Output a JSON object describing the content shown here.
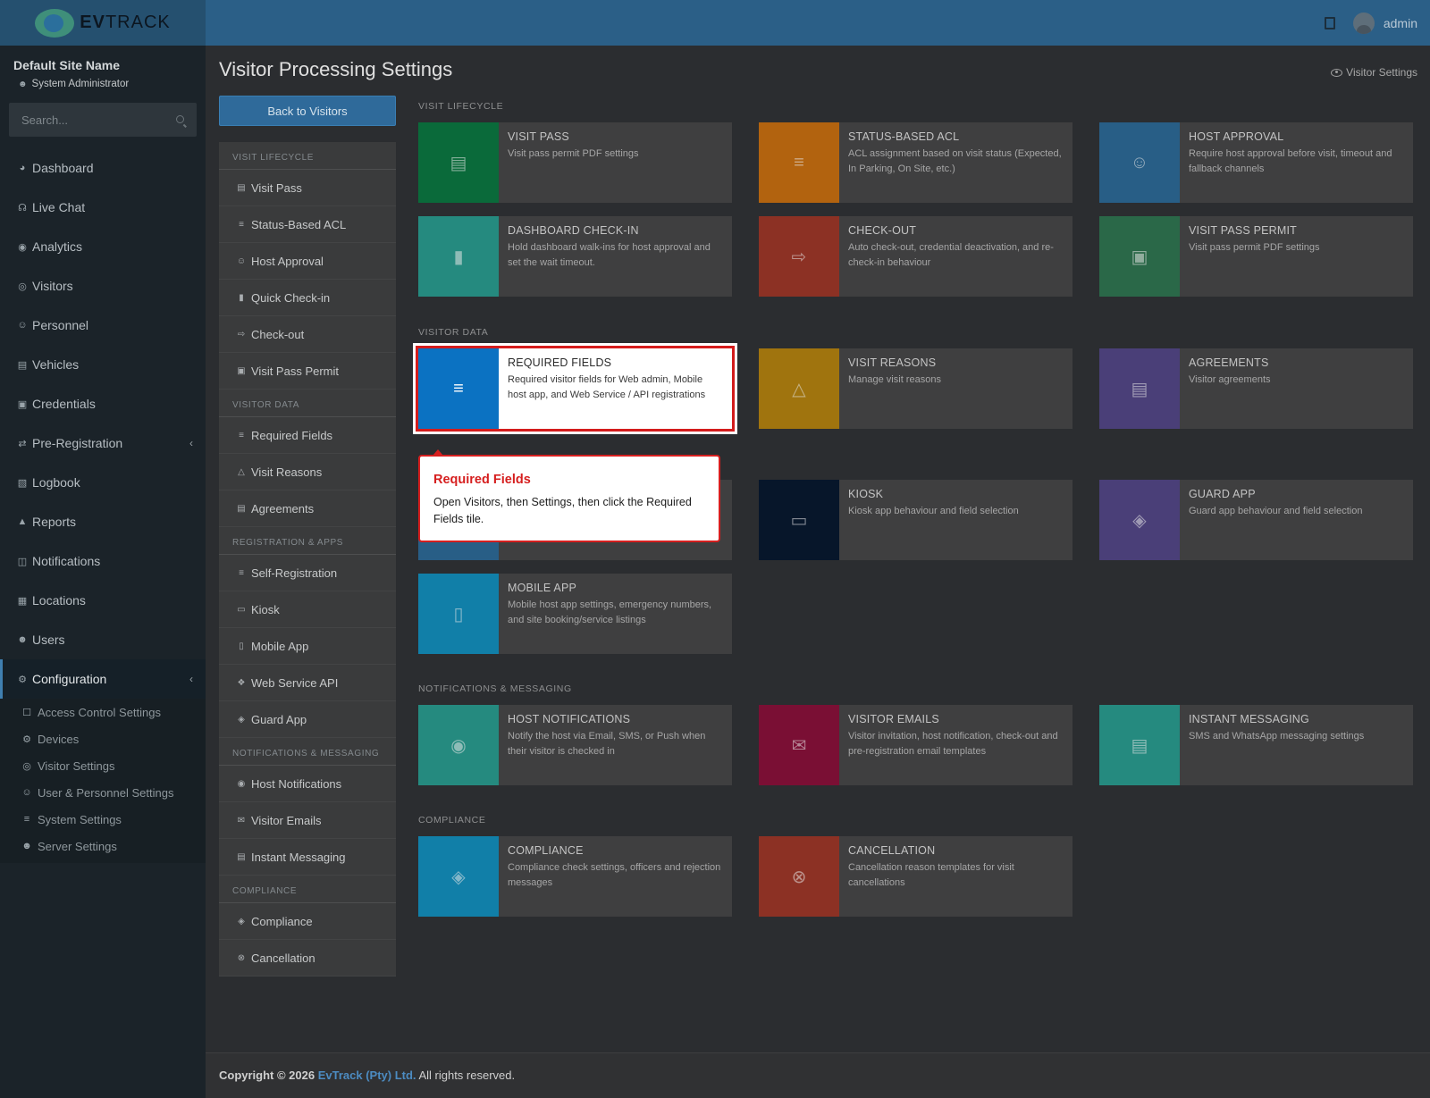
{
  "brand": {
    "name_bold": "EV",
    "name_rest": "TRACK"
  },
  "topbar": {
    "user": "admin"
  },
  "sidebar": {
    "site_name": "Default Site Name",
    "role": "System Administrator",
    "search_placeholder": "Search...",
    "items": [
      {
        "label": "Dashboard",
        "icon": "dashboard-icon"
      },
      {
        "label": "Live Chat",
        "icon": "headset-icon"
      },
      {
        "label": "Analytics",
        "icon": "analytics-icon"
      },
      {
        "label": "Visitors",
        "icon": "eye-icon"
      },
      {
        "label": "Personnel",
        "icon": "personnel-icon"
      },
      {
        "label": "Vehicles",
        "icon": "vehicle-icon"
      },
      {
        "label": "Credentials",
        "icon": "credentials-icon"
      },
      {
        "label": "Pre-Registration",
        "icon": "pre-registration-icon"
      },
      {
        "label": "Logbook",
        "icon": "logbook-icon"
      },
      {
        "label": "Reports",
        "icon": "reports-icon"
      },
      {
        "label": "Notifications",
        "icon": "notifications-icon"
      },
      {
        "label": "Locations",
        "icon": "locations-icon"
      },
      {
        "label": "Users",
        "icon": "users-icon"
      },
      {
        "label": "Configuration",
        "icon": "gear-icon"
      }
    ],
    "config_sub": [
      {
        "label": "Access Control Settings"
      },
      {
        "label": "Devices"
      },
      {
        "label": "Visitor Settings"
      },
      {
        "label": "User & Personnel Settings"
      },
      {
        "label": "System Settings"
      },
      {
        "label": "Server Settings"
      }
    ]
  },
  "page": {
    "title": "Visitor Processing Settings",
    "crumb": "Visitor Settings",
    "back_button": "Back to Visitors"
  },
  "menu": {
    "sections": [
      {
        "heading": "VISIT LIFECYCLE",
        "items": [
          "Visit Pass",
          "Status-Based ACL",
          "Host Approval",
          "Quick Check-in",
          "Check-out",
          "Visit Pass Permit"
        ]
      },
      {
        "heading": "VISITOR DATA",
        "items": [
          "Required Fields",
          "Visit Reasons",
          "Agreements"
        ]
      },
      {
        "heading": "REGISTRATION & APPS",
        "items": [
          "Self-Registration",
          "Kiosk",
          "Mobile App",
          "Web Service API",
          "Guard App"
        ]
      },
      {
        "heading": "NOTIFICATIONS & MESSAGING",
        "items": [
          "Host Notifications",
          "Visitor Emails",
          "Instant Messaging"
        ]
      },
      {
        "heading": "COMPLIANCE",
        "items": [
          "Compliance",
          "Cancellation"
        ]
      }
    ]
  },
  "tiles": {
    "sections": {
      "lifecycle": "VISIT LIFECYCLE",
      "visitor_data": "VISITOR DATA",
      "notifications": "NOTIFICATIONS & MESSAGING",
      "compliance": "COMPLIANCE"
    },
    "visit_pass": {
      "title": "VISIT PASS",
      "desc": "Visit pass permit PDF settings",
      "color": "#0a6a3a"
    },
    "status_acl": {
      "title": "STATUS-BASED ACL",
      "desc": "ACL assignment based on visit status (Expected, In Parking, On Site, etc.)",
      "color": "#b2630f"
    },
    "host_approval": {
      "title": "HOST APPROVAL",
      "desc": "Require host approval before visit, timeout and fallback channels",
      "color": "#285e86"
    },
    "dashboard_checkin": {
      "title": "DASHBOARD CHECK-IN",
      "desc": "Hold dashboard walk-ins for host approval and set the wait timeout.",
      "color": "#258a7f"
    },
    "checkout": {
      "title": "CHECK-OUT",
      "desc": "Auto check-out, credential deactivation, and re-check-in behaviour",
      "color": "#8c3124"
    },
    "visit_pass_permit": {
      "title": "VISIT PASS PERMIT",
      "desc": "Visit pass permit PDF settings",
      "color": "#2a6848"
    },
    "required_fields": {
      "title": "REQUIRED FIELDS",
      "desc": "Required visitor fields for Web admin, Mobile host app, and Web Service / API registrations",
      "color": "#0b72c2"
    },
    "visit_reasons": {
      "title": "VISIT REASONS",
      "desc": "Manage visit reasons",
      "color": "#a0740e"
    },
    "agreements": {
      "title": "AGREEMENTS",
      "desc": "Visitor agreements",
      "color": "#4a3f78"
    },
    "kiosk": {
      "title": "KIOSK",
      "desc": "Kiosk app behaviour and field selection",
      "color": "#07162a"
    },
    "guard_app": {
      "title": "GUARD APP",
      "desc": "Guard app behaviour and field selection",
      "color": "#4a3f78"
    },
    "mobile_app": {
      "title": "MOBILE APP",
      "desc": "Mobile host app settings, emergency numbers, and site booking/service listings",
      "color": "#117fa8"
    },
    "host_notifications": {
      "title": "HOST NOTIFICATIONS",
      "desc": "Notify the host via Email, SMS, or Push when their visitor is checked in",
      "color": "#258a7f"
    },
    "visitor_emails": {
      "title": "VISITOR EMAILS",
      "desc": "Visitor invitation, host notification, check-out and pre-registration email templates",
      "color": "#7a0f34"
    },
    "instant_messaging": {
      "title": "INSTANT MESSAGING",
      "desc": "SMS and WhatsApp messaging settings",
      "color": "#258a7f"
    },
    "compliance": {
      "title": "COMPLIANCE",
      "desc": "Compliance check settings, officers and rejection messages",
      "color": "#117fa8"
    },
    "cancellation": {
      "title": "CANCELLATION",
      "desc": "Cancellation reason templates for visit cancellations",
      "color": "#8c3124"
    }
  },
  "tooltip": {
    "title": "Required Fields",
    "body": "Open Visitors, then Settings, then click the Required Fields tile."
  },
  "footer": {
    "prefix": "Copyright © 2026",
    "company": "EvTrack (Pty) Ltd.",
    "suffix": "All rights reserved."
  }
}
